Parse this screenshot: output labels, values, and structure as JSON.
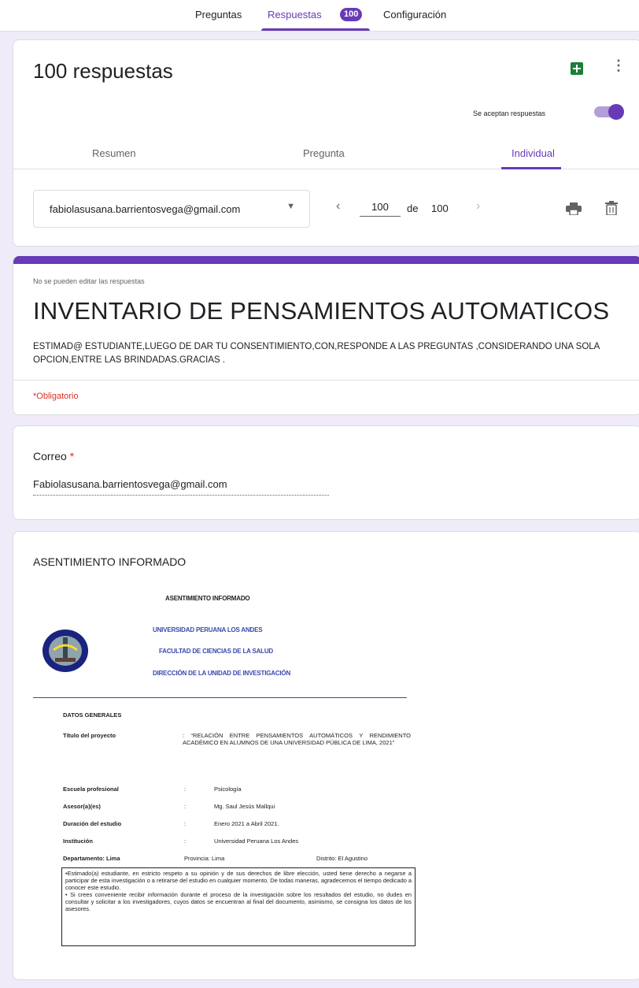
{
  "top_tabs": {
    "preguntas": "Preguntas",
    "respuestas": "Respuestas",
    "respuestas_count": "100",
    "configuracion": "Configuración"
  },
  "responses": {
    "title": "100 respuestas",
    "accepting_label": "Se aceptan respuestas",
    "sub_tabs": [
      "Resumen",
      "Pregunta",
      "Individual"
    ],
    "selected_email": "fabiolasusana.barrientosvega@gmail.com",
    "page_current": "100",
    "page_of": "de",
    "page_total": "100"
  },
  "form": {
    "no_edit_note": "No se pueden editar las respuestas",
    "title": "INVENTARIO DE PENSAMIENTOS AUTOMATICOS",
    "description": "ESTIMAD@ ESTUDIANTE,LUEGO DE DAR TU CONSENTIMIENTO,CON,RESPONDE A LAS PREGUNTAS ,CONSIDERANDO UNA SOLA OPCION,ENTRE LAS BRINDADAS.GRACIAS .",
    "required_note": "*Obligatorio"
  },
  "email_question": {
    "label": "Correo",
    "required_mark": "*",
    "value": "Fabiolasusana.barrientosvega@gmail.com"
  },
  "consent": {
    "section_title": "ASENTIMIENTO INFORMADO",
    "doc_heading": "ASENTIMIENTO INFORMADO",
    "university": "UNIVERSIDAD PERUANA LOS ANDES",
    "faculty": "FACULTAD DE CIENCIAS DE LA SALUD",
    "direction": "DIRECCIÓN DE LA UNIDAD DE INVESTIGACIÓN",
    "general_data": "DATOS GENERALES",
    "project_label": "Título del proyecto",
    "project_value": ": “RELACIÓN ENTRE PENSAMIENTOS AUTOMÁTICOS Y RENDIMIENTO ACADÉMICO EN ALUMNOS DE UNA UNIVERSIDAD PÚBLICA DE LIMA, 2021”",
    "school_label": "Escuela profesional",
    "school_value": "Psicología",
    "advisor_label": "Asesor(a)(es)",
    "advisor_value": "Mg. Saul Jesús Mallqui",
    "duration_label": "Duración del estudio",
    "duration_value": "Enero 2021 a Abril 2021.",
    "institution_label": "Institución",
    "institution_value": "Universidad Peruana Los Andes",
    "department_label": "Departamento: Lima",
    "province": "Provincia: Lima",
    "district": "Distrito: El Agustino",
    "colon": ":",
    "box_p1": "•Estimado(a) estudiante, en estricto respeto a su opinión y de sus derechos de libre elección, usted tiene derecho a negarse a participar de esta investigación o a retirarse del estudio en cualquier momento. De todas maneras, agradecemos el tiempo dedicado a conocer este estudio.",
    "box_p2": "• Si crees conveniente recibir información durante el proceso de la investigación sobre los resultados del estudio, no dudes en consultar y solicitar a los investigadores, cuyos datos se encuentran al final del documento, asimismo, se consigna los datos de los asesores."
  },
  "colors": {
    "accent": "#673ab7",
    "background": "#f0ebf8",
    "required": "#d93025",
    "sheets": "#188038"
  }
}
